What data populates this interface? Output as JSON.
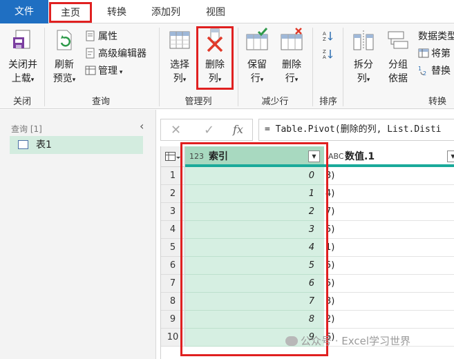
{
  "tabs": {
    "file": "文件",
    "home": "主页",
    "transform": "转换",
    "add_column": "添加列",
    "view": "视图"
  },
  "ribbon": {
    "close_load": [
      "关闭并",
      "上载"
    ],
    "close_group": "关闭",
    "refresh_preview": [
      "刷新",
      "预览"
    ],
    "properties": "属性",
    "advanced_editor": "高级编辑器",
    "manage": "管理",
    "query_group": "查询",
    "choose_columns": [
      "选择",
      "列"
    ],
    "remove_columns": [
      "删除",
      "列"
    ],
    "manage_columns_group": "管理列",
    "keep_rows": [
      "保留",
      "行"
    ],
    "remove_rows": [
      "删除",
      "行"
    ],
    "reduce_rows_group": "减少行",
    "sort_group": "排序",
    "split_column": [
      "拆分",
      "列"
    ],
    "group_by": [
      "分组",
      "依据"
    ],
    "data_type": "数据类型",
    "use_first_row": "将第",
    "replace_values": "替换",
    "transform_group": "转换"
  },
  "queries_pane": {
    "header": "查询 [1]",
    "items": [
      {
        "label": "表1"
      }
    ]
  },
  "formula_bar": {
    "cancel": "✕",
    "commit": "✓",
    "fx": "fx",
    "expression": "= Table.Pivot(删除的列, List.Disti"
  },
  "grid": {
    "columns": [
      {
        "type_icon": "123",
        "name": "索引"
      },
      {
        "type_icon": "ABC",
        "name": "数值.1"
      }
    ],
    "rows": [
      {
        "n": "1",
        "index": "0",
        "value": "3)"
      },
      {
        "n": "2",
        "index": "1",
        "value": "4)"
      },
      {
        "n": "3",
        "index": "2",
        "value": "7)"
      },
      {
        "n": "4",
        "index": "3",
        "value": "5)"
      },
      {
        "n": "5",
        "index": "4",
        "value": "1)"
      },
      {
        "n": "6",
        "index": "5",
        "value": "5)"
      },
      {
        "n": "7",
        "index": "6",
        "value": "5)"
      },
      {
        "n": "8",
        "index": "7",
        "value": "3)"
      },
      {
        "n": "9",
        "index": "8",
        "value": "2)"
      },
      {
        "n": "10",
        "index": "9",
        "value": "6)"
      }
    ]
  },
  "watermark": "公众号 · Excel学习世界"
}
